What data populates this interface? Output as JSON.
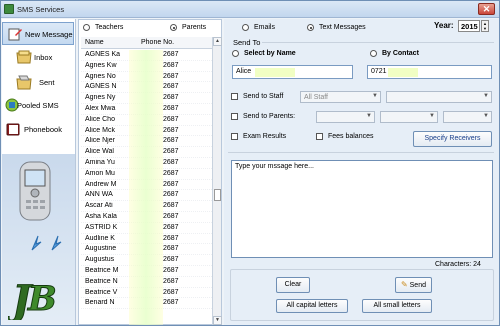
{
  "window": {
    "title": "SMS Services",
    "close_glyph": "✕"
  },
  "sidebar": {
    "items": [
      {
        "label": "New Message",
        "icon": "new-message-icon"
      },
      {
        "label": "Inbox",
        "icon": "inbox-icon"
      },
      {
        "label": "Sent",
        "icon": "sent-icon"
      },
      {
        "label": "Pooled SMS",
        "icon": "pooled-sms-icon"
      },
      {
        "label": "Phonebook",
        "icon": "phonebook-icon"
      }
    ],
    "logo_text": "JB"
  },
  "contacts": {
    "radio_teachers": "Teachers",
    "radio_parents": "Parents",
    "selected": "Parents",
    "col_name": "Name",
    "col_phone": "Phone No.",
    "rows": [
      {
        "name": "AGNES Ka",
        "phone": "2687"
      },
      {
        "name": "Agnes Kw",
        "phone": "2687"
      },
      {
        "name": "Agnes No",
        "phone": "2687"
      },
      {
        "name": "AGNES N",
        "phone": "2687"
      },
      {
        "name": "Agnes Ny",
        "phone": "2687"
      },
      {
        "name": "Alex Mwa",
        "phone": "2687"
      },
      {
        "name": "Alice Cho",
        "phone": "2687"
      },
      {
        "name": "Alice Mck",
        "phone": "2687"
      },
      {
        "name": "Alice Njer",
        "phone": "2687"
      },
      {
        "name": "Alice Wal",
        "phone": "2687"
      },
      {
        "name": "Amina Yu",
        "phone": "2687"
      },
      {
        "name": "Amon Mu",
        "phone": "2687"
      },
      {
        "name": "Andrew M",
        "phone": "2687"
      },
      {
        "name": "ANN WA",
        "phone": "2687"
      },
      {
        "name": "Ascar Ati",
        "phone": "2687"
      },
      {
        "name": "Asha Kala",
        "phone": "2687"
      },
      {
        "name": "ASTRID K",
        "phone": "2687"
      },
      {
        "name": "Audline K",
        "phone": "2687"
      },
      {
        "name": "Augustine",
        "phone": "2687"
      },
      {
        "name": "Augustus",
        "phone": "2687"
      },
      {
        "name": "Beatrice M",
        "phone": "2687"
      },
      {
        "name": "Beatrice N",
        "phone": "2687"
      },
      {
        "name": "Beatrice V",
        "phone": "2687"
      },
      {
        "name": "Benard N",
        "phone": "2687"
      }
    ]
  },
  "compose": {
    "radio_emails": "Emails",
    "radio_text": "Text Messages",
    "selected_mode": "Text Messages",
    "year_label": "Year:",
    "year_value": "2015",
    "send_to_label": "Send To",
    "select_by_name": "Select by Name",
    "by_contact": "By Contact",
    "name_value": "Alice",
    "contact_value": "0721",
    "send_to_staff": "Send to Staff",
    "staff_combo": "All Staff",
    "send_to_parents": "Send to Parents:",
    "exam_results": "Exam Results",
    "fees_balances": "Fees balances",
    "specify_receivers": "Specify Receivers",
    "message_placeholder": "Type your mssage here...",
    "characters_label": "Characters: 24",
    "clear": "Clear",
    "send": "Send",
    "all_capital": "All capital letters",
    "all_small": "All small letters"
  }
}
